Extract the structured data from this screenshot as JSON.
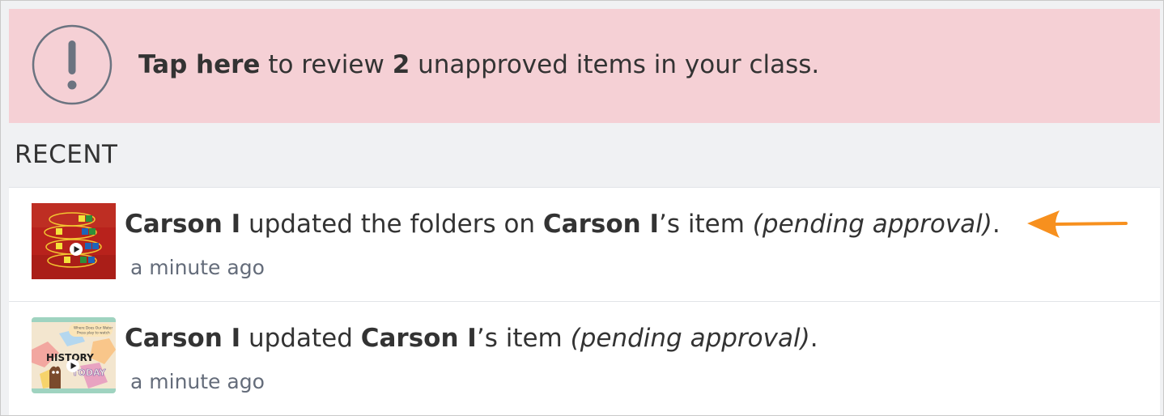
{
  "alert": {
    "lead": "Tap here",
    "mid": " to review ",
    "count": "2",
    "tail": " unapproved items in your class.",
    "icon": "exclamation-circle-icon",
    "background": "#f5d0d5"
  },
  "recent": {
    "title": "RECENT",
    "items": [
      {
        "actor": "Carson I",
        "action": " updated the folders on ",
        "owner": "Carson I",
        "suffix": "’s item ",
        "status": "(pending approval)",
        "end": ".",
        "time": "a minute ago",
        "thumbnail": "video-thumbnail-counting-blocks"
      },
      {
        "actor": "Carson I",
        "action": " updated ",
        "owner": "Carson I",
        "suffix": "’s item ",
        "status": "(pending approval)",
        "end": ".",
        "time": "a minute ago",
        "thumbnail": "video-thumbnail-history-today",
        "thumbnail_text": {
          "line1": "Where Does Our Water",
          "line2": "Press play to watch",
          "title_a": "HISTORY",
          "title_b": "TODAY"
        }
      }
    ]
  },
  "annotation": {
    "icon": "arrow-left-icon",
    "color": "#f7901e"
  }
}
